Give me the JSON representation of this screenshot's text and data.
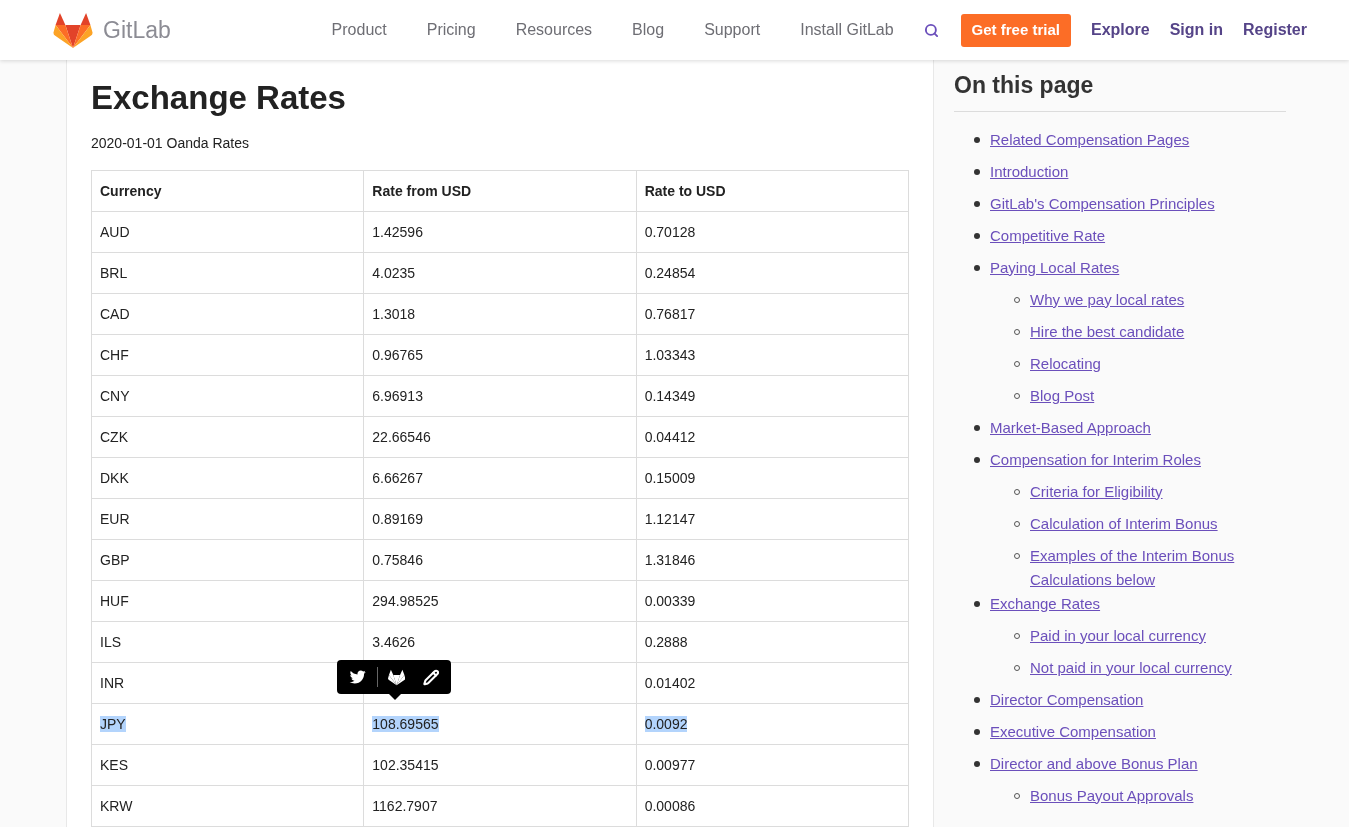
{
  "header": {
    "brand": "GitLab",
    "nav": [
      "Product",
      "Pricing",
      "Resources",
      "Blog",
      "Support",
      "Install GitLab"
    ],
    "trial_button": "Get free trial",
    "links": [
      "Explore",
      "Sign in",
      "Register"
    ]
  },
  "article": {
    "title": "Exchange Rates",
    "subtitle": "2020-01-01 Oanda Rates",
    "table": {
      "columns": [
        "Currency",
        "Rate from USD",
        "Rate to USD"
      ],
      "rows": [
        {
          "cells": [
            "AUD",
            "1.42596",
            "0.70128"
          ],
          "selected": false
        },
        {
          "cells": [
            "BRL",
            "4.0235",
            "0.24854"
          ],
          "selected": false
        },
        {
          "cells": [
            "CAD",
            "1.3018",
            "0.76817"
          ],
          "selected": false
        },
        {
          "cells": [
            "CHF",
            "0.96765",
            "1.03343"
          ],
          "selected": false
        },
        {
          "cells": [
            "CNY",
            "6.96913",
            "0.14349"
          ],
          "selected": false
        },
        {
          "cells": [
            "CZK",
            "22.66546",
            "0.04412"
          ],
          "selected": false
        },
        {
          "cells": [
            "DKK",
            "6.66267",
            "0.15009"
          ],
          "selected": false
        },
        {
          "cells": [
            "EUR",
            "0.89169",
            "1.12147"
          ],
          "selected": false
        },
        {
          "cells": [
            "GBP",
            "0.75846",
            "1.31846"
          ],
          "selected": false
        },
        {
          "cells": [
            "HUF",
            "294.98525",
            "0.00339"
          ],
          "selected": false
        },
        {
          "cells": [
            "ILS",
            "3.4626",
            "0.2888"
          ],
          "selected": false
        },
        {
          "cells": [
            "INR",
            "",
            "0.01402"
          ],
          "selected": false,
          "share_popup": true
        },
        {
          "cells": [
            "JPY",
            "108.69565",
            "0.0092"
          ],
          "selected": true
        },
        {
          "cells": [
            "KES",
            "102.35415",
            "0.00977"
          ],
          "selected": false
        },
        {
          "cells": [
            "KRW",
            "1162.7907",
            "0.00086"
          ],
          "selected": false
        }
      ]
    }
  },
  "toc": {
    "title": "On this page",
    "items": [
      {
        "label": "Related Compensation Pages"
      },
      {
        "label": "Introduction"
      },
      {
        "label": "GitLab's Compensation Principles"
      },
      {
        "label": "Competitive Rate"
      },
      {
        "label": "Paying Local Rates",
        "children": [
          {
            "label": "Why we pay local rates"
          },
          {
            "label": "Hire the best candidate"
          },
          {
            "label": "Relocating"
          },
          {
            "label": "Blog Post"
          }
        ]
      },
      {
        "label": "Market-Based Approach"
      },
      {
        "label": "Compensation for Interim Roles",
        "children": [
          {
            "label": "Criteria for Eligibility"
          },
          {
            "label": "Calculation of Interim Bonus"
          },
          {
            "label": "Examples of the Interim Bonus Calculations below"
          }
        ]
      },
      {
        "label": "Exchange Rates",
        "children": [
          {
            "label": "Paid in your local currency"
          },
          {
            "label": "Not paid in your local currency"
          }
        ]
      },
      {
        "label": "Director Compensation"
      },
      {
        "label": "Executive Compensation"
      },
      {
        "label": "Director and above Bonus Plan",
        "children": [
          {
            "label": "Bonus Payout Approvals"
          }
        ]
      }
    ]
  }
}
